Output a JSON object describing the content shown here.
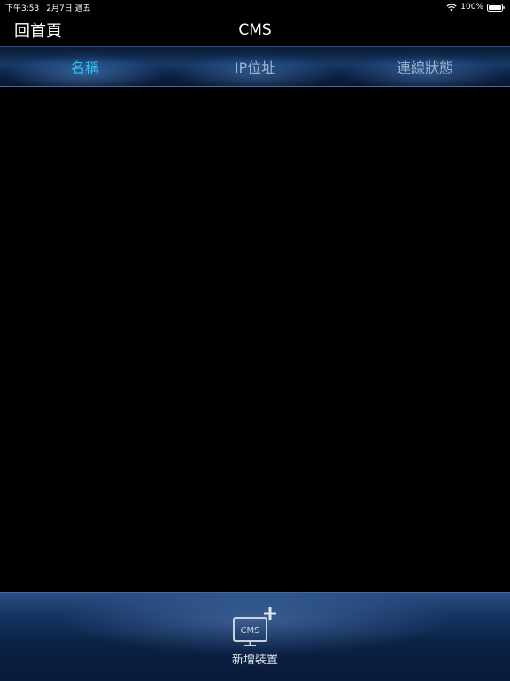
{
  "status_bar": {
    "time": "下午3:53",
    "date": "2月7日 週五",
    "battery": "100%",
    "wifi_icon": "wifi-icon",
    "battery_icon": "battery-full-icon"
  },
  "nav": {
    "back_label": "回首頁",
    "title": "CMS"
  },
  "columns": {
    "name": "名稱",
    "ip": "IP位址",
    "status": "連線狀態"
  },
  "colors": {
    "active_column": "#2ec0f0",
    "inactive_column": "#9db3cc"
  },
  "devices": [],
  "toolbar": {
    "add_device_label": "新增裝置",
    "add_device_icon_text": "CMS",
    "add_device_icon": "monitor-add-icon"
  }
}
